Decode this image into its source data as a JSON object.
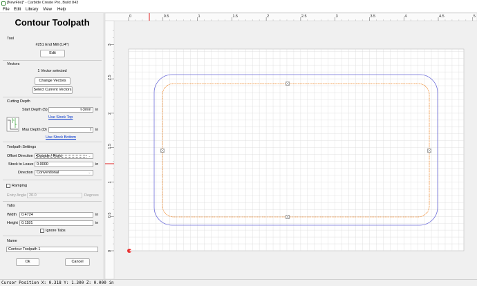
{
  "window": {
    "title": "[NewFile]* - Carbide Create Pro, Build 843"
  },
  "menu": [
    "File",
    "Edit",
    "Library",
    "View",
    "Help"
  ],
  "panel": {
    "title": "Contour Toolpath",
    "tool": {
      "section": "Tool",
      "name": "#251 End Mill (1/4\")",
      "edit_label": "Edit"
    },
    "vectors": {
      "section": "Vectors",
      "selected_text": "1 Vector selected",
      "change_label": "Change Vectors",
      "select_label": "Select Current Vectors"
    },
    "cutting_depth": {
      "section": "Cutting Depth",
      "start_label": "Start Depth (S)",
      "start_value": "t-3mm",
      "start_unit": "in",
      "use_top": "Use Stock Top",
      "max_label": "Max Depth (D)",
      "max_value": "t",
      "max_unit": "in",
      "use_bottom": "Use Stock Bottom",
      "diagram_s": "S",
      "diagram_d": "D"
    },
    "toolpath_settings": {
      "section": "Toolpath Settings",
      "offset_label": "Offset Direction",
      "offset_value": "Outside / Right",
      "stock_label": "Stock to Leave",
      "stock_value": "0.0000",
      "stock_unit": "in",
      "direction_label": "Direction",
      "direction_value": "Conventional"
    },
    "ramping": {
      "label": "Ramping",
      "angle_label": "Entry Angle",
      "angle_value": "20.0",
      "angle_unit": "Degrees"
    },
    "tabs": {
      "section": "Tabs",
      "width_label": "Width",
      "width_value": "0.4724",
      "width_unit": "in",
      "height_label": "Height",
      "height_value": "0.1181",
      "height_unit": "in",
      "ignore_label": "Ignore Tabs"
    },
    "name": {
      "section": "Name",
      "value": "Contour Toolpath 1"
    },
    "ok_label": "Ok",
    "cancel_label": "Cancel"
  },
  "ruler": {
    "top_labels": [
      "0",
      "0.5",
      "1",
      "1.5",
      "2",
      "2.5",
      "3",
      "3.5",
      "4",
      "4.5",
      "5"
    ],
    "left_labels": [
      "3",
      "2.5",
      "2",
      "1.5",
      "1",
      "0.5",
      "0"
    ]
  },
  "colors": {
    "vector": "#6b6bd9",
    "toolpath": "#f08a2e",
    "grid": "#d9d9d9",
    "ruler_marker": "#e02020"
  },
  "status": {
    "text": "Cursor Position X: 0.318 Y: 1.300 Z: 0.000 in"
  }
}
